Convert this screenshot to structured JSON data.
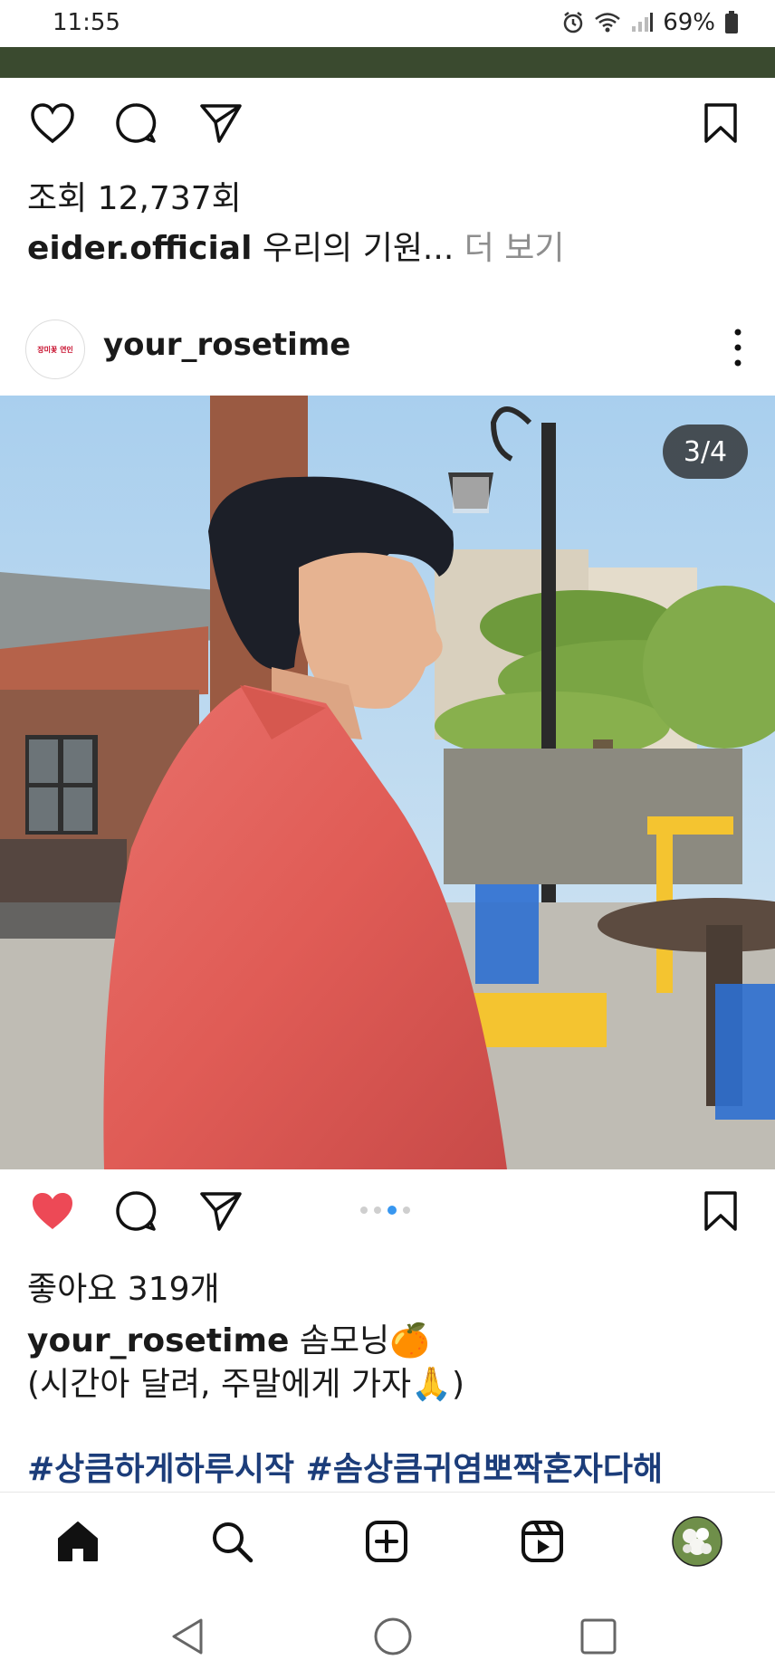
{
  "status_bar": {
    "time": "11:55",
    "battery": "69%"
  },
  "prev_post": {
    "views": "조회 12,737회",
    "caption_user": "eider.official",
    "caption_text": "우리의 기원...",
    "more_label": "더 보기"
  },
  "post": {
    "username": "your_rosetime",
    "avatar_text": "장미꽃 연인",
    "counter": "3/4",
    "carousel": {
      "total": 4,
      "active_index": 2,
      "visible_dots": 3
    },
    "likes": "좋아요 319개",
    "caption_user": "your_rosetime",
    "caption_line1": "솜모닝🍊",
    "caption_line2": "(시간아 달려, 주말에게 가자🙏)",
    "hashtags": "#상큼하게하루시작 #솜상큼귀염뽀짝혼자다해",
    "liked": true
  },
  "colors": {
    "like_red": "#ed4956",
    "hashtag_blue": "#1c3d7a",
    "dot_active": "#3897f0"
  },
  "icons": [
    "heart-icon",
    "comment-icon",
    "share-icon",
    "bookmark-icon",
    "more-icon",
    "home-icon",
    "search-icon",
    "add-icon",
    "reels-icon",
    "profile-avatar"
  ]
}
